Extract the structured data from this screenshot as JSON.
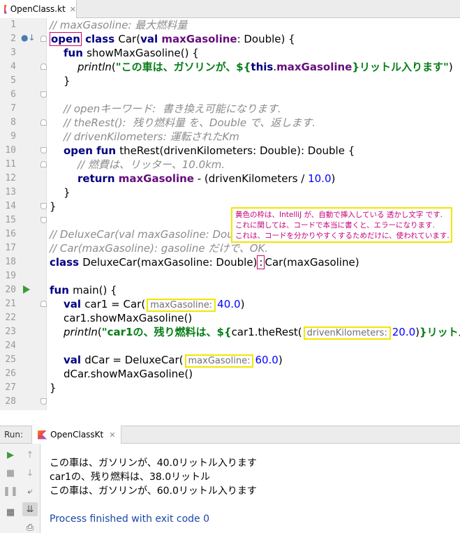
{
  "editor_tab": {
    "file_name": "OpenClass.kt",
    "close": "✕"
  },
  "line_numbers": [
    "1",
    "2",
    "3",
    "4",
    "5",
    "6",
    "7",
    "8",
    "9",
    "10",
    "11",
    "12",
    "13",
    "14",
    "15",
    "16",
    "17",
    "18",
    "19",
    "20",
    "21",
    "22",
    "23",
    "24",
    "25",
    "26",
    "27",
    "28"
  ],
  "code": {
    "l1": "// maxGasoline: 最大燃料量",
    "l2_open": "open",
    "l2_class": " class ",
    "l2_name": "Car(",
    "l2_val": "val ",
    "l2_prop": "maxGasoline",
    "l2_rest": ": Double) {",
    "l3_fun": "fun ",
    "l3_rest": "showMaxGasoline() {",
    "l4_println": "println",
    "l4_p": "(",
    "l4_str1": "\"この車は、ガソリンが、${",
    "l4_this": "this",
    "l4_dot": ".",
    "l4_prop": "maxGasoline",
    "l4_str2": "}リットル入ります\"",
    "l4_end": ")",
    "l5": "}",
    "l7": "// openキーワード:  書き換え可能になります.",
    "l8": "// theRest():  残り燃料量 を、Double で、返します.",
    "l9": "// drivenKilometers: 運転されたKm",
    "l10_kw": "open fun ",
    "l10_rest": "theRest(drivenKilometers: Double): Double {",
    "l11": "// 燃費は、リッター、10.0km.",
    "l12_kw": "return ",
    "l12_prop": "maxGasoline",
    "l12_rest": " - (drivenKilometers / ",
    "l12_num": "10.0",
    "l12_end": ")",
    "l13": "}",
    "l14": "}",
    "l16": "// DeluxeCar(val maxGasoline: Double): 間違い、val は、不要.",
    "l17": "// Car(maxGasoline): gasoline だけで、OK.",
    "l18_kw": "class ",
    "l18_rest": "DeluxeCar(maxGasoline: Double)",
    "l18_colon": ":",
    "l18_end": "Car(maxGasoline)",
    "l20_kw": "fun ",
    "l20_rest": "main() {",
    "l21_kw": "val ",
    "l21_rest": "car1 = Car(",
    "l21_hint": "maxGasoline:",
    "l21_num": "40.0",
    "l21_end": ")",
    "l22": "car1.showMaxGasoline()",
    "l23_println": "println",
    "l23_p": "(",
    "l23_str1": "\"car1の、残り燃料は、${",
    "l23_call": "car1.theRest(",
    "l23_hint": "drivenKilometers:",
    "l23_num": "20.0",
    "l23_call_end": ")",
    "l23_str2": "}リットル\"",
    "l23_end": ")",
    "l25_kw": "val ",
    "l25_rest": "dCar = DeluxeCar(",
    "l25_hint": "maxGasoline:",
    "l25_num": "60.0",
    "l25_end": ")",
    "l26": "dCar.showMaxGasoline()",
    "l27": "}"
  },
  "note": {
    "line1": "黄色の枠は、IntelliJ が、自動で挿入している 透かし文字 です.",
    "line2": "これに関しては、コードで本当に書くと、エラーになります.",
    "line3": "これは、コードを分かりやすくするためだけに、使われています."
  },
  "run_panel": {
    "label": "Run:",
    "tab": "OpenClassKt",
    "close": "✕"
  },
  "console": {
    "out1": "この車は、ガソリンが、40.0リットル入ります",
    "out2": "car1の、残り燃料は、38.0リットル",
    "out3": "この車は、ガソリンが、60.0リットル入ります",
    "out4": "Process finished with exit code 0"
  },
  "colors": {
    "keyword": "#000080",
    "property": "#660e7a",
    "string": "#067d17",
    "number": "#0000ff",
    "comment": "#8c8c8c",
    "hint_border": "#f2e600",
    "annotation": "#d4006b"
  }
}
